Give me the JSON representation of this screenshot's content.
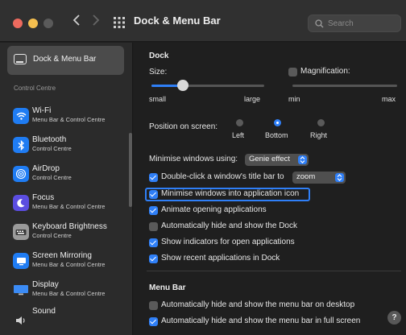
{
  "window": {
    "title": "Dock & Menu Bar",
    "search_placeholder": "Search"
  },
  "sidebar": {
    "selected": {
      "label": "Dock & Menu Bar"
    },
    "section_title": "Control Centre",
    "items": [
      {
        "label": "Wi-Fi",
        "sub": "Menu Bar & Control Centre",
        "icon": "wifi-icon",
        "color": "#1f7cf3"
      },
      {
        "label": "Bluetooth",
        "sub": "Control Centre",
        "icon": "bluetooth-icon",
        "color": "#1f7cf3"
      },
      {
        "label": "AirDrop",
        "sub": "Control Centre",
        "icon": "airdrop-icon",
        "color": "#1f7cf3"
      },
      {
        "label": "Focus",
        "sub": "Menu Bar & Control Centre",
        "icon": "moon-icon",
        "color": "#5b4de0"
      },
      {
        "label": "Keyboard Brightness",
        "sub": "Control Centre",
        "icon": "keyboard-brightness-icon",
        "color": "#8a8a8a"
      },
      {
        "label": "Screen Mirroring",
        "sub": "Menu Bar & Control Centre",
        "icon": "screen-mirroring-icon",
        "color": "#1f7cf3"
      },
      {
        "label": "Display",
        "sub": "Menu Bar & Control Centre",
        "icon": "display-icon",
        "color": "#1f7cf3"
      },
      {
        "label": "Sound",
        "sub": "",
        "icon": "speaker-icon",
        "color": "#8a8a8a"
      }
    ]
  },
  "dock": {
    "section_title": "Dock",
    "size": {
      "label": "Size:",
      "min_label": "small",
      "max_label": "large",
      "value": 0.28
    },
    "magnification": {
      "label": "Magnification:",
      "checked": false,
      "min_label": "min",
      "max_label": "max",
      "value": 0.0
    },
    "position": {
      "label": "Position on screen:",
      "options": [
        "Left",
        "Bottom",
        "Right"
      ],
      "selected": "Bottom"
    },
    "minimise_using": {
      "label": "Minimise windows using:",
      "value": "Genie effect"
    },
    "double_click": {
      "label": "Double-click a window's title bar to",
      "value": "zoom",
      "checked": true
    },
    "options": [
      {
        "label": "Minimise windows into application icon",
        "checked": true,
        "focused": true
      },
      {
        "label": "Animate opening applications",
        "checked": true
      },
      {
        "label": "Automatically hide and show the Dock",
        "checked": false
      },
      {
        "label": "Show indicators for open applications",
        "checked": true
      },
      {
        "label": "Show recent applications in Dock",
        "checked": true
      }
    ]
  },
  "menubar": {
    "section_title": "Menu Bar",
    "options": [
      {
        "label": "Automatically hide and show the menu bar on desktop",
        "checked": false
      },
      {
        "label": "Automatically hide and show the menu bar in full screen",
        "checked": true
      }
    ]
  },
  "help_label": "?"
}
